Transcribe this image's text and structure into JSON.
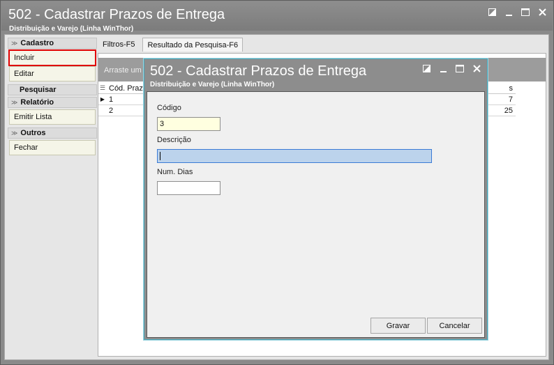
{
  "window": {
    "title": "502 - Cadastrar Prazos de Entrega",
    "subtitle": "Distribuição e Varejo (Linha WinThor)"
  },
  "sidebar": {
    "cadastro_header": "Cadastro",
    "incluir": "Incluir",
    "editar": "Editar",
    "pesquisar_header": "Pesquisar",
    "relatorio_header": "Relatório",
    "emitir_lista": "Emitir Lista",
    "outros_header": "Outros",
    "fechar": "Fechar"
  },
  "tabs": [
    {
      "label": "Filtros-F5",
      "active": false
    },
    {
      "label": "Resultado da Pesquisa-F6",
      "active": true
    }
  ],
  "grid": {
    "group_by_text": "Arraste um c",
    "col_codigo": "Cód. Prazo",
    "col_dias": "s",
    "rows": [
      {
        "codigo": "1",
        "dias": "7"
      },
      {
        "codigo": "2",
        "dias": "25"
      }
    ]
  },
  "dialog": {
    "title": "502 - Cadastrar Prazos de Entrega",
    "subtitle": "Distribuição e Varejo (Linha WinThor)",
    "codigo_label": "Código",
    "codigo_value": "3",
    "descricao_label": "Descrição",
    "descricao_value": "",
    "num_dias_label": "Num. Dias",
    "num_dias_value": "",
    "gravar_label": "Gravar",
    "cancelar_label": "Cancelar"
  },
  "colors": {
    "title_bar": "#8a8a8a",
    "highlight": "#e00000",
    "focused_input": "#bcd3ec",
    "code_input": "#ffffe0"
  }
}
